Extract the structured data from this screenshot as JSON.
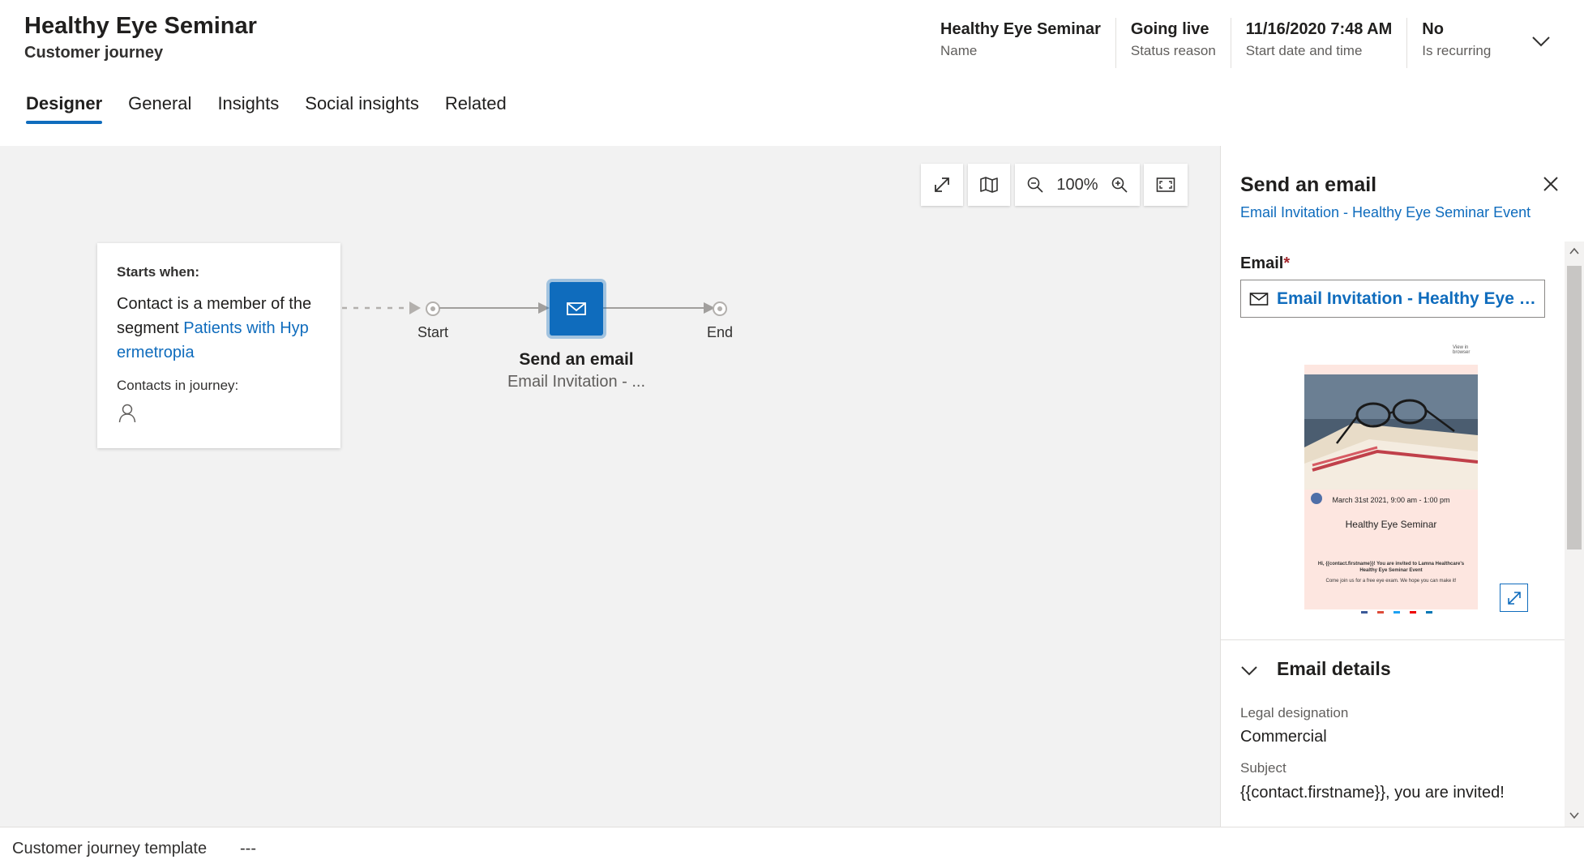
{
  "header": {
    "title": "Healthy Eye Seminar",
    "subtitle": "Customer journey",
    "fields": [
      {
        "value": "Healthy Eye Seminar",
        "label": "Name"
      },
      {
        "value": "Going live",
        "label": "Status reason"
      },
      {
        "value": "11/16/2020 7:48 AM",
        "label": "Start date and time"
      },
      {
        "value": "No",
        "label": "Is recurring"
      }
    ]
  },
  "tabs": [
    "Designer",
    "General",
    "Insights",
    "Social insights",
    "Related"
  ],
  "toolbar": {
    "zoom": "100%"
  },
  "trigger": {
    "starts_when": "Starts when:",
    "desc_prefix": "Contact is a member of the segment ",
    "segment": "Patients with Hyp ermetropia",
    "contacts_label": "Contacts in journey:"
  },
  "flow": {
    "start": "Start",
    "end": "End",
    "node_title": "Send an email",
    "node_sub": "Email Invitation - ..."
  },
  "panel": {
    "title": "Send an email",
    "link": "Email Invitation - Healthy Eye Seminar Event",
    "email_label": "Email",
    "email_value": "Email Invitation - Healthy Eye Seminar Event",
    "preview": {
      "view_in_browser": "View in browser",
      "date": "March 31st 2021, 9:00 am - 1:00 pm",
      "heading": "Healthy Eye Seminar",
      "invite": "Hi, {{contact.firstname}}! You are invited to Lamna Healthcare's Healthy Eye Seminar Event",
      "body": "Come join us for a free eye exam. We hope you can make it!"
    },
    "details_title": "Email details",
    "legal_label": "Legal designation",
    "legal_value": "Commercial",
    "subject_label": "Subject",
    "subject_value": "{{contact.firstname}}, you are invited!"
  },
  "footer": {
    "label": "Customer journey template",
    "value": "---"
  },
  "colors": {
    "accent": "#0f6cbd",
    "canvas": "#f2f2f2"
  }
}
